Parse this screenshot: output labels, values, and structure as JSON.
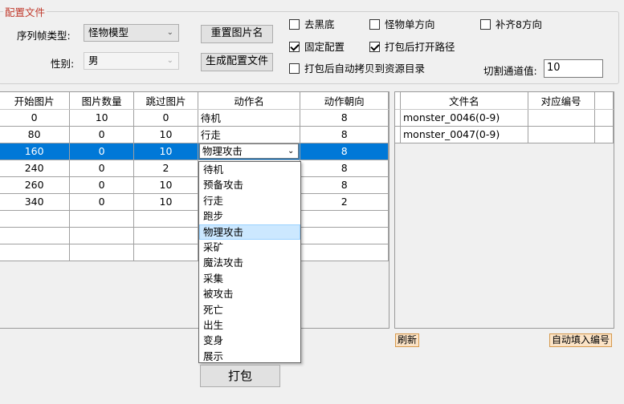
{
  "config": {
    "group_title": "配置文件",
    "sequence_label": "序列帧类型:",
    "sequence_value": "怪物模型",
    "gender_label": "性别:",
    "gender_value": "男",
    "reset_names_button": "重置图片名",
    "generate_config_button": "生成配置文件",
    "checkboxes": {
      "remove_black": {
        "label": "去黑底",
        "checked": false
      },
      "monster_single_dir": {
        "label": "怪物单方向",
        "checked": false
      },
      "fill_8_dirs": {
        "label": "补齐8方向",
        "checked": false
      },
      "fixed_config": {
        "label": "固定配置",
        "checked": true
      },
      "open_path_after_pack": {
        "label": "打包后打开路径",
        "checked": true
      },
      "auto_copy": {
        "label": "打包后自动拷贝到资源目录",
        "checked": false
      }
    },
    "cut_channel_label": "切割通道值:",
    "cut_channel_value": "10"
  },
  "left_table": {
    "headers": [
      "开始图片",
      "图片数量",
      "跳过图片",
      "动作名",
      "动作朝向"
    ],
    "rows": [
      [
        "0",
        "10",
        "0",
        "待机",
        "8"
      ],
      [
        "80",
        "0",
        "10",
        "行走",
        "8"
      ],
      [
        "160",
        "0",
        "10",
        "物理攻击",
        "8"
      ],
      [
        "240",
        "0",
        "2",
        "",
        "8"
      ],
      [
        "260",
        "0",
        "10",
        "",
        "8"
      ],
      [
        "340",
        "0",
        "10",
        "",
        "2"
      ]
    ],
    "selected_row_index": 2
  },
  "action_dropdown": {
    "items": [
      "待机",
      "预备攻击",
      "行走",
      "跑步",
      "物理攻击",
      "采矿",
      "魔法攻击",
      "采集",
      "被攻击",
      "死亡",
      "出生",
      "变身",
      "展示"
    ],
    "highlighted": "物理攻击"
  },
  "right_table": {
    "headers": [
      "文件名",
      "对应编号"
    ],
    "rows": [
      [
        "monster_0046(0-9)",
        ""
      ],
      [
        "monster_0047(0-9)",
        ""
      ]
    ]
  },
  "buttons": {
    "refresh": "刷新",
    "auto_fill": "自动填入编号",
    "pack": "打包"
  }
}
